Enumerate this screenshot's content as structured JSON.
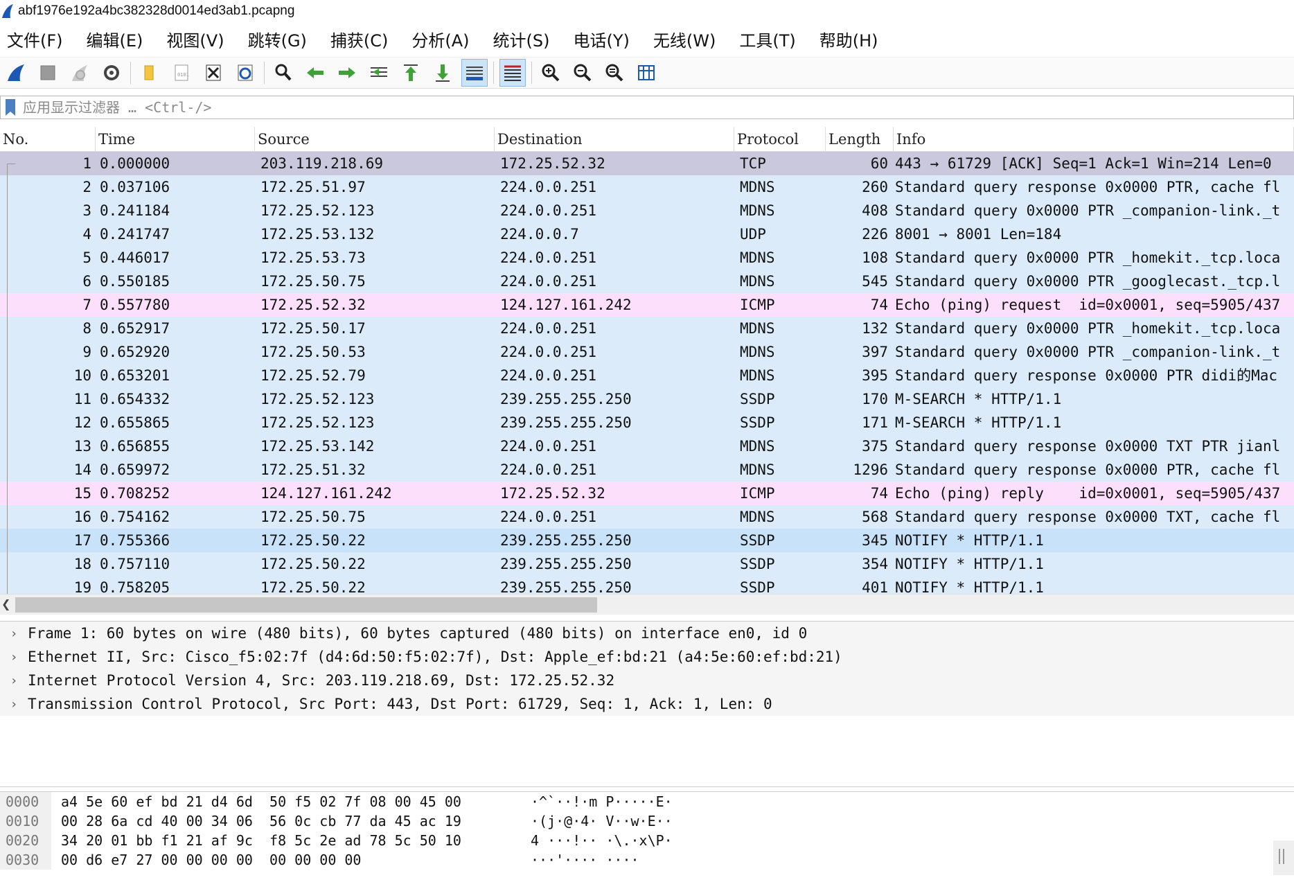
{
  "window": {
    "title": "abf1976e192a4bc382328d0014ed3ab1.pcapng"
  },
  "menu": [
    "文件(F)",
    "编辑(E)",
    "视图(V)",
    "跳转(G)",
    "捕获(C)",
    "分析(A)",
    "统计(S)",
    "电话(Y)",
    "无线(W)",
    "工具(T)",
    "帮助(H)"
  ],
  "toolbar": {
    "icons": [
      "shark-fin-start-icon",
      "stop-capture-icon",
      "restart-capture-icon",
      "capture-options-icon",
      "open-file-icon",
      "save-file-icon",
      "close-file-icon",
      "reload-file-icon",
      "find-packet-icon",
      "go-back-icon",
      "go-forward-icon",
      "go-to-packet-icon",
      "go-first-icon",
      "go-last-icon",
      "autoscroll-icon",
      "colorize-icon",
      "zoom-in-icon",
      "zoom-out-icon",
      "zoom-normal-icon",
      "resize-columns-icon"
    ],
    "colors": {
      "accent": "#1e58b5",
      "arrow_green": "#3ea236",
      "selected_bg": "#cde3f7"
    }
  },
  "filter": {
    "placeholder": "应用显示过滤器 … <Ctrl-/>"
  },
  "packet_list": {
    "columns": [
      "No.",
      "Time",
      "Source",
      "Destination",
      "Protocol",
      "Length",
      "Info"
    ],
    "row_colors": {
      "selected": "#c9c8dc",
      "udp_light": "#dbebf9",
      "icmp": "#fce0fb",
      "ssdp_highlight": "#c7e2f9"
    },
    "rows": [
      {
        "no": "1",
        "time": "0.000000",
        "src": "203.119.218.69",
        "dst": "172.25.52.32",
        "proto": "TCP",
        "len": "60",
        "info": "443 → 61729 [ACK] Seq=1 Ack=1 Win=214 Len=0",
        "color": "#c9c8dc"
      },
      {
        "no": "2",
        "time": "0.037106",
        "src": "172.25.51.97",
        "dst": "224.0.0.251",
        "proto": "MDNS",
        "len": "260",
        "info": "Standard query response 0x0000 PTR, cache fl",
        "color": "#dbebf9"
      },
      {
        "no": "3",
        "time": "0.241184",
        "src": "172.25.52.123",
        "dst": "224.0.0.251",
        "proto": "MDNS",
        "len": "408",
        "info": "Standard query 0x0000 PTR _companion-link._t",
        "color": "#dbebf9"
      },
      {
        "no": "4",
        "time": "0.241747",
        "src": "172.25.53.132",
        "dst": "224.0.0.7",
        "proto": "UDP",
        "len": "226",
        "info": "8001 → 8001 Len=184",
        "color": "#dbebf9"
      },
      {
        "no": "5",
        "time": "0.446017",
        "src": "172.25.53.73",
        "dst": "224.0.0.251",
        "proto": "MDNS",
        "len": "108",
        "info": "Standard query 0x0000 PTR _homekit._tcp.loca",
        "color": "#dbebf9"
      },
      {
        "no": "6",
        "time": "0.550185",
        "src": "172.25.50.75",
        "dst": "224.0.0.251",
        "proto": "MDNS",
        "len": "545",
        "info": "Standard query 0x0000 PTR _googlecast._tcp.l",
        "color": "#dbebf9"
      },
      {
        "no": "7",
        "time": "0.557780",
        "src": "172.25.52.32",
        "dst": "124.127.161.242",
        "proto": "ICMP",
        "len": "74",
        "info": "Echo (ping) request  id=0x0001, seq=5905/437",
        "color": "#fce0fb"
      },
      {
        "no": "8",
        "time": "0.652917",
        "src": "172.25.50.17",
        "dst": "224.0.0.251",
        "proto": "MDNS",
        "len": "132",
        "info": "Standard query 0x0000 PTR _homekit._tcp.loca",
        "color": "#dbebf9"
      },
      {
        "no": "9",
        "time": "0.652920",
        "src": "172.25.50.53",
        "dst": "224.0.0.251",
        "proto": "MDNS",
        "len": "397",
        "info": "Standard query 0x0000 PTR _companion-link._t",
        "color": "#dbebf9"
      },
      {
        "no": "10",
        "time": "0.653201",
        "src": "172.25.52.79",
        "dst": "224.0.0.251",
        "proto": "MDNS",
        "len": "395",
        "info": "Standard query response 0x0000 PTR didi的Mac",
        "color": "#dbebf9"
      },
      {
        "no": "11",
        "time": "0.654332",
        "src": "172.25.52.123",
        "dst": "239.255.255.250",
        "proto": "SSDP",
        "len": "170",
        "info": "M-SEARCH * HTTP/1.1",
        "color": "#dbebf9"
      },
      {
        "no": "12",
        "time": "0.655865",
        "src": "172.25.52.123",
        "dst": "239.255.255.250",
        "proto": "SSDP",
        "len": "171",
        "info": "M-SEARCH * HTTP/1.1",
        "color": "#dbebf9"
      },
      {
        "no": "13",
        "time": "0.656855",
        "src": "172.25.53.142",
        "dst": "224.0.0.251",
        "proto": "MDNS",
        "len": "375",
        "info": "Standard query response 0x0000 TXT PTR jianl",
        "color": "#dbebf9"
      },
      {
        "no": "14",
        "time": "0.659972",
        "src": "172.25.51.32",
        "dst": "224.0.0.251",
        "proto": "MDNS",
        "len": "1296",
        "info": "Standard query response 0x0000 PTR, cache fl",
        "color": "#dbebf9"
      },
      {
        "no": "15",
        "time": "0.708252",
        "src": "124.127.161.242",
        "dst": "172.25.52.32",
        "proto": "ICMP",
        "len": "74",
        "info": "Echo (ping) reply    id=0x0001, seq=5905/437",
        "color": "#fce0fb"
      },
      {
        "no": "16",
        "time": "0.754162",
        "src": "172.25.50.75",
        "dst": "224.0.0.251",
        "proto": "MDNS",
        "len": "568",
        "info": "Standard query response 0x0000 TXT, cache fl",
        "color": "#dbebf9"
      },
      {
        "no": "17",
        "time": "0.755366",
        "src": "172.25.50.22",
        "dst": "239.255.255.250",
        "proto": "SSDP",
        "len": "345",
        "info": "NOTIFY * HTTP/1.1",
        "color": "#c7e2f9"
      },
      {
        "no": "18",
        "time": "0.757110",
        "src": "172.25.50.22",
        "dst": "239.255.255.250",
        "proto": "SSDP",
        "len": "354",
        "info": "NOTIFY * HTTP/1.1",
        "color": "#dbebf9"
      },
      {
        "no": "19",
        "time": "0.758205",
        "src": "172.25.50.22",
        "dst": "239.255.255.250",
        "proto": "SSDP",
        "len": "401",
        "info": "NOTIFY * HTTP/1.1",
        "color": "#dbebf9"
      }
    ]
  },
  "details": [
    "Frame 1: 60 bytes on wire (480 bits), 60 bytes captured (480 bits) on interface en0, id 0",
    "Ethernet II, Src: Cisco_f5:02:7f (d4:6d:50:f5:02:7f), Dst: Apple_ef:bd:21 (a4:5e:60:ef:bd:21)",
    "Internet Protocol Version 4, Src: 203.119.218.69, Dst: 172.25.52.32",
    "Transmission Control Protocol, Src Port: 443, Dst Port: 61729, Seq: 1, Ack: 1, Len: 0"
  ],
  "bytes": [
    {
      "offset": "0000",
      "hex": "a4 5e 60 ef bd 21 d4 6d  50 f5 02 7f 08 00 45 00",
      "ascii": "·^`··!·m P·····E·"
    },
    {
      "offset": "0010",
      "hex": "00 28 6a cd 40 00 34 06  56 0c cb 77 da 45 ac 19",
      "ascii": "·(j·@·4· V··w·E··"
    },
    {
      "offset": "0020",
      "hex": "34 20 01 bb f1 21 af 9c  f8 5c 2e ad 78 5c 50 10",
      "ascii": "4 ···!·· ·\\.·x\\P·"
    },
    {
      "offset": "0030",
      "hex": "00 d6 e7 27 00 00 00 00  00 00 00 00",
      "ascii": "···'···· ····"
    }
  ]
}
